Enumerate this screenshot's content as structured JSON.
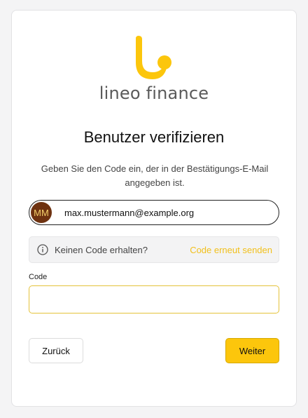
{
  "brand": {
    "name": "lineo finance",
    "logo_icon": "lineo-logo-icon",
    "accent_color": "#fcc60c"
  },
  "page": {
    "title": "Benutzer verifizieren",
    "subtitle": "Geben Sie den Code ein, der in der Bestätigungs-E-Mail angegeben ist."
  },
  "identity": {
    "initials": "MM",
    "email": "max.mustermann@example.org"
  },
  "resend": {
    "icon": "info-icon",
    "text": "Keinen Code erhalten?",
    "link_label": "Code erneut senden"
  },
  "code_field": {
    "label": "Code",
    "value": "",
    "placeholder": ""
  },
  "actions": {
    "back_label": "Zurück",
    "next_label": "Weiter"
  }
}
